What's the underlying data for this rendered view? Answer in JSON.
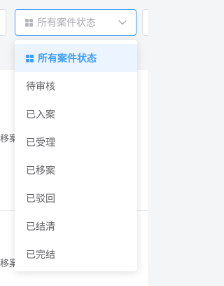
{
  "filter": {
    "placeholder": "所有案件状态",
    "icon": "grid-icon",
    "chevron_icon": "chevron-down-icon",
    "accent_color": "#409eff"
  },
  "dropdown": {
    "options": [
      {
        "label": "所有案件状态",
        "selected": true
      },
      {
        "label": "待审核"
      },
      {
        "label": "已入案"
      },
      {
        "label": "已受理"
      },
      {
        "label": "已移案"
      },
      {
        "label": "已驳回"
      },
      {
        "label": "已结清"
      },
      {
        "label": "已完结"
      }
    ]
  },
  "background": {
    "row_text_1": "移案",
    "row_text_2": "移案"
  }
}
